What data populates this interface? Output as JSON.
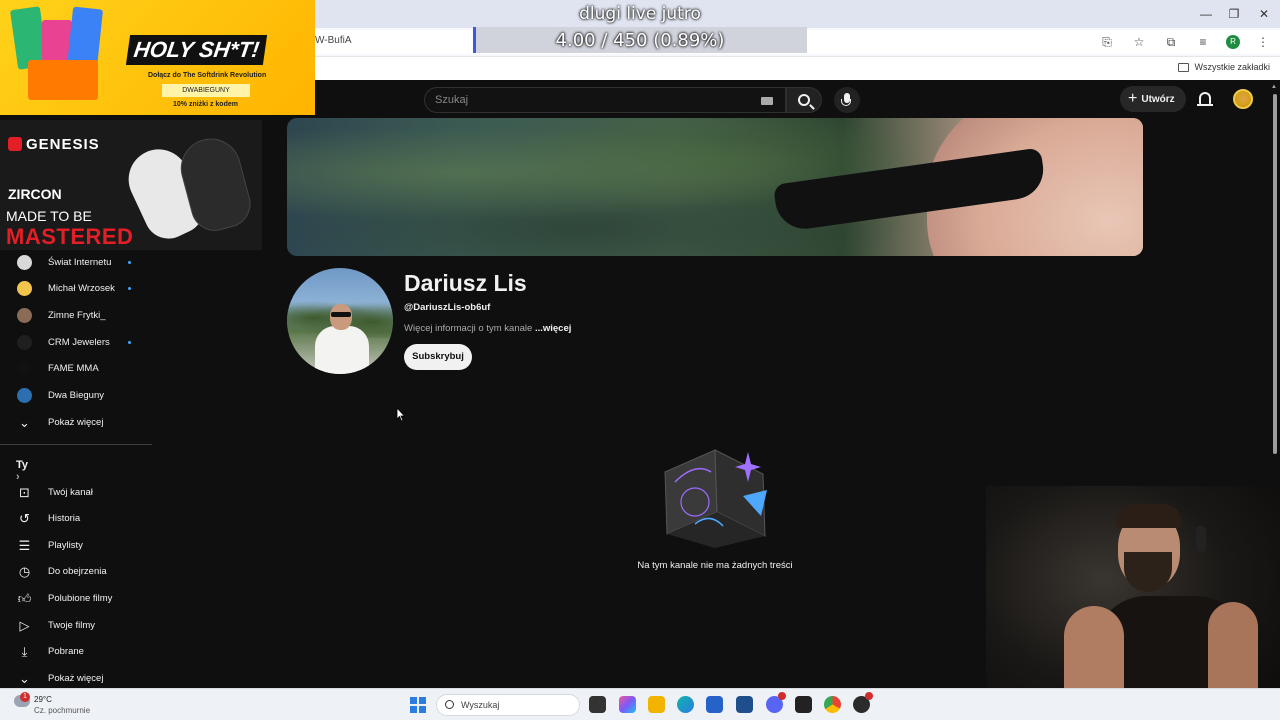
{
  "overlay": {
    "title": "dlugi live jutro",
    "progress_text": "4.00 / 450 (0.89%)",
    "progress_fraction": 0.0089
  },
  "browser": {
    "address_text": "W-BufiA",
    "bookmarks_all": "Wszystkie zakładki",
    "profile_letter": "R"
  },
  "ads": {
    "holy": {
      "title": "HOLY SH*T!",
      "subtitle": "Dołącz do The Softdrink Revolution",
      "code": "DWABIEGUNY",
      "discount": "10% zniżki z kodem"
    },
    "genesis": {
      "brand": "GENESIS",
      "product": "ZIRCON",
      "line1": "MADE TO BE",
      "line2": "MASTERED"
    }
  },
  "header": {
    "search_placeholder": "Szukaj",
    "create_label": "Utwórz"
  },
  "sidebar": {
    "subscriptions": [
      {
        "label": "Świat Internetu",
        "new": true,
        "color": "#d9d9d9"
      },
      {
        "label": "Michał Wrzosek",
        "new": true,
        "color": "#f2c44b"
      },
      {
        "label": "Zimne Frytki_",
        "new": false,
        "color": "#8a6b55"
      },
      {
        "label": "CRM Jewelers",
        "new": true,
        "color": "#1f1f1f"
      },
      {
        "label": "FAME MMA",
        "new": false,
        "color": "#111111"
      },
      {
        "label": "Dwa Bieguny",
        "new": false,
        "color": "#2c6fb0"
      }
    ],
    "show_more": "Pokaż więcej",
    "you_section": "Ty",
    "you_items": [
      {
        "label": "Twój kanał",
        "icon": "channel-icon"
      },
      {
        "label": "Historia",
        "icon": "history-icon"
      },
      {
        "label": "Playlisty",
        "icon": "playlist-icon"
      },
      {
        "label": "Do obejrzenia",
        "icon": "watch-later-icon"
      },
      {
        "label": "Polubione filmy",
        "icon": "like-icon"
      },
      {
        "label": "Twoje filmy",
        "icon": "video-icon"
      },
      {
        "label": "Pobrane",
        "icon": "download-icon"
      }
    ],
    "show_more_2": "Pokaż więcej"
  },
  "channel": {
    "name": "Dariusz Lis",
    "handle": "@DariuszLis-ob6uf",
    "description": "Więcej informacji o tym kanale",
    "more": "...więcej",
    "subscribe_label": "Subskrybuj",
    "empty_message": "Na tym kanale nie ma żadnych treści"
  },
  "taskbar": {
    "weather_badge": "1",
    "weather_temp": "29°C",
    "weather_desc": "Cz. pochmurnie",
    "search_placeholder": "Wyszukaj"
  },
  "colors": {
    "yt_bg": "#0f0f0f",
    "accent_blue": "#3ea6ff",
    "progress_blue": "#3b5bdb"
  }
}
